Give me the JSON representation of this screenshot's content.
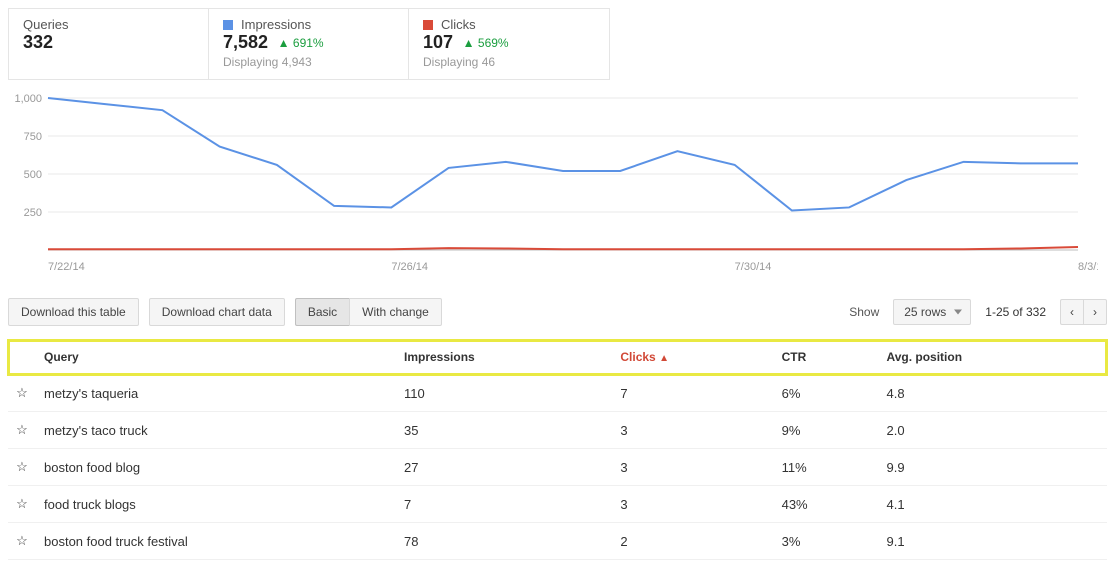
{
  "stats": {
    "queries": {
      "label": "Queries",
      "value": "332"
    },
    "impress": {
      "label": "Impressions",
      "value": "7,582",
      "change": "691%",
      "sub": "Displaying 4,943"
    },
    "clicks": {
      "label": "Clicks",
      "value": "107",
      "change": "569%",
      "sub": "Displaying 46"
    }
  },
  "toolbar": {
    "download_table": "Download this table",
    "download_chart": "Download chart data",
    "basic": "Basic",
    "with_change": "With change",
    "show_label": "Show",
    "rows_select": "25 rows",
    "range": "1-25 of 332"
  },
  "chart_data": {
    "type": "line",
    "yticks": [
      "1,000",
      "750",
      "500",
      "250"
    ],
    "xticks": [
      "7/22/14",
      "7/26/14",
      "7/30/14",
      "8/3/14"
    ],
    "ylim": [
      0,
      1000
    ],
    "series": [
      {
        "name": "Impressions",
        "color": "#5b92e5",
        "values": [
          1050,
          960,
          920,
          680,
          560,
          290,
          280,
          540,
          580,
          520,
          520,
          650,
          560,
          260,
          280,
          460,
          580,
          570,
          570
        ]
      },
      {
        "name": "Clicks",
        "color": "#d94a38",
        "values": [
          5,
          5,
          5,
          5,
          5,
          5,
          5,
          12,
          10,
          5,
          5,
          5,
          5,
          5,
          5,
          5,
          5,
          10,
          20
        ]
      }
    ]
  },
  "table": {
    "headers": {
      "query": "Query",
      "impressions": "Impressions",
      "clicks": "Clicks",
      "ctr": "CTR",
      "avg": "Avg. position"
    },
    "rows": [
      {
        "query": "metzy's taqueria",
        "impressions": "110",
        "clicks": "7",
        "ctr": "6%",
        "avg": "4.8"
      },
      {
        "query": "metzy's taco truck",
        "impressions": "35",
        "clicks": "3",
        "ctr": "9%",
        "avg": "2.0"
      },
      {
        "query": "boston food blog",
        "impressions": "27",
        "clicks": "3",
        "ctr": "11%",
        "avg": "9.9"
      },
      {
        "query": "food truck blogs",
        "impressions": "7",
        "clicks": "3",
        "ctr": "43%",
        "avg": "4.1"
      },
      {
        "query": "boston food truck festival",
        "impressions": "78",
        "clicks": "2",
        "ctr": "3%",
        "avg": "9.1"
      }
    ]
  }
}
